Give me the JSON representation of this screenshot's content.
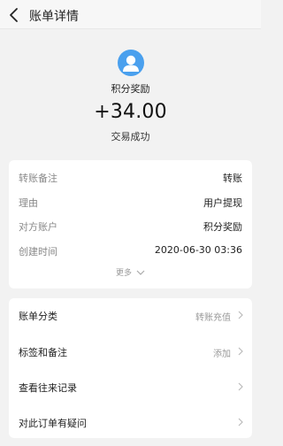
{
  "header": {
    "title": "账单详情"
  },
  "summary": {
    "merchant": "积分奖励",
    "amount": "+34.00",
    "status": "交易成功"
  },
  "details": [
    {
      "label": "转账备注",
      "value": "转账"
    },
    {
      "label": "理由",
      "value": "用户提现"
    },
    {
      "label": "对方账户",
      "value": "积分奖励"
    },
    {
      "label": "创建时间",
      "value": "2020-06-30 03:36"
    }
  ],
  "more_label": "更多",
  "menu": [
    {
      "label": "账单分类",
      "value": "转账充值"
    },
    {
      "label": "标签和备注",
      "value": "添加"
    },
    {
      "label": "查看往来记录",
      "value": ""
    },
    {
      "label": "对此订单有疑问",
      "value": ""
    }
  ],
  "colors": {
    "accent": "#4aa0ee",
    "background": "#f2f2f2"
  }
}
